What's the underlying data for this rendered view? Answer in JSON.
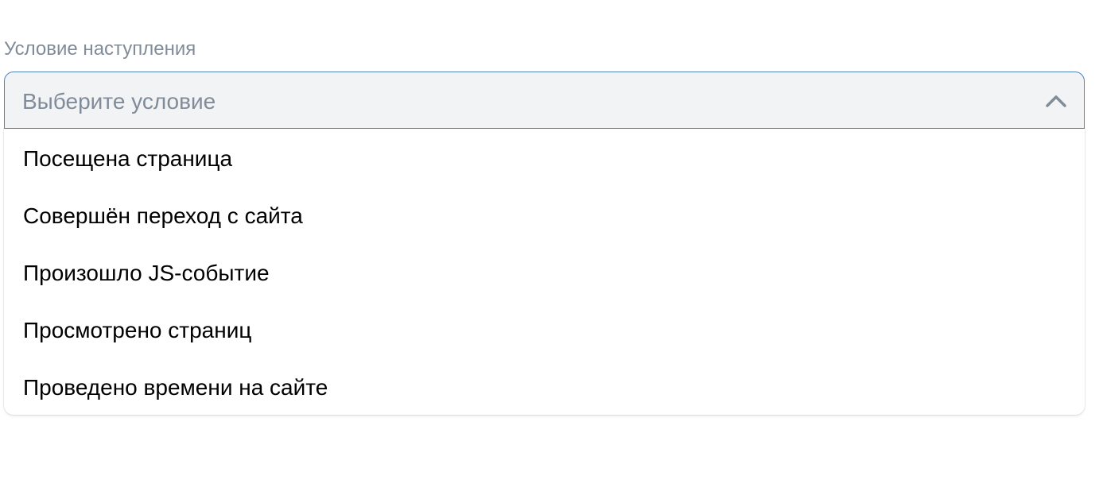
{
  "field": {
    "label": "Условие наступления",
    "placeholder": "Выберите условие",
    "expanded": true,
    "chevron_icon": "chevron-up-icon"
  },
  "options": [
    {
      "label": "Посещена страница"
    },
    {
      "label": "Совершён переход с сайта"
    },
    {
      "label": "Произошло JS-событие"
    },
    {
      "label": "Просмотрено страниц"
    },
    {
      "label": "Проведено времени на сайте"
    }
  ],
  "colors": {
    "label": "#818c99",
    "select_bg": "#f2f3f5",
    "select_border": "#5181b8",
    "option_text": "#000000",
    "chevron": "#818c99"
  }
}
